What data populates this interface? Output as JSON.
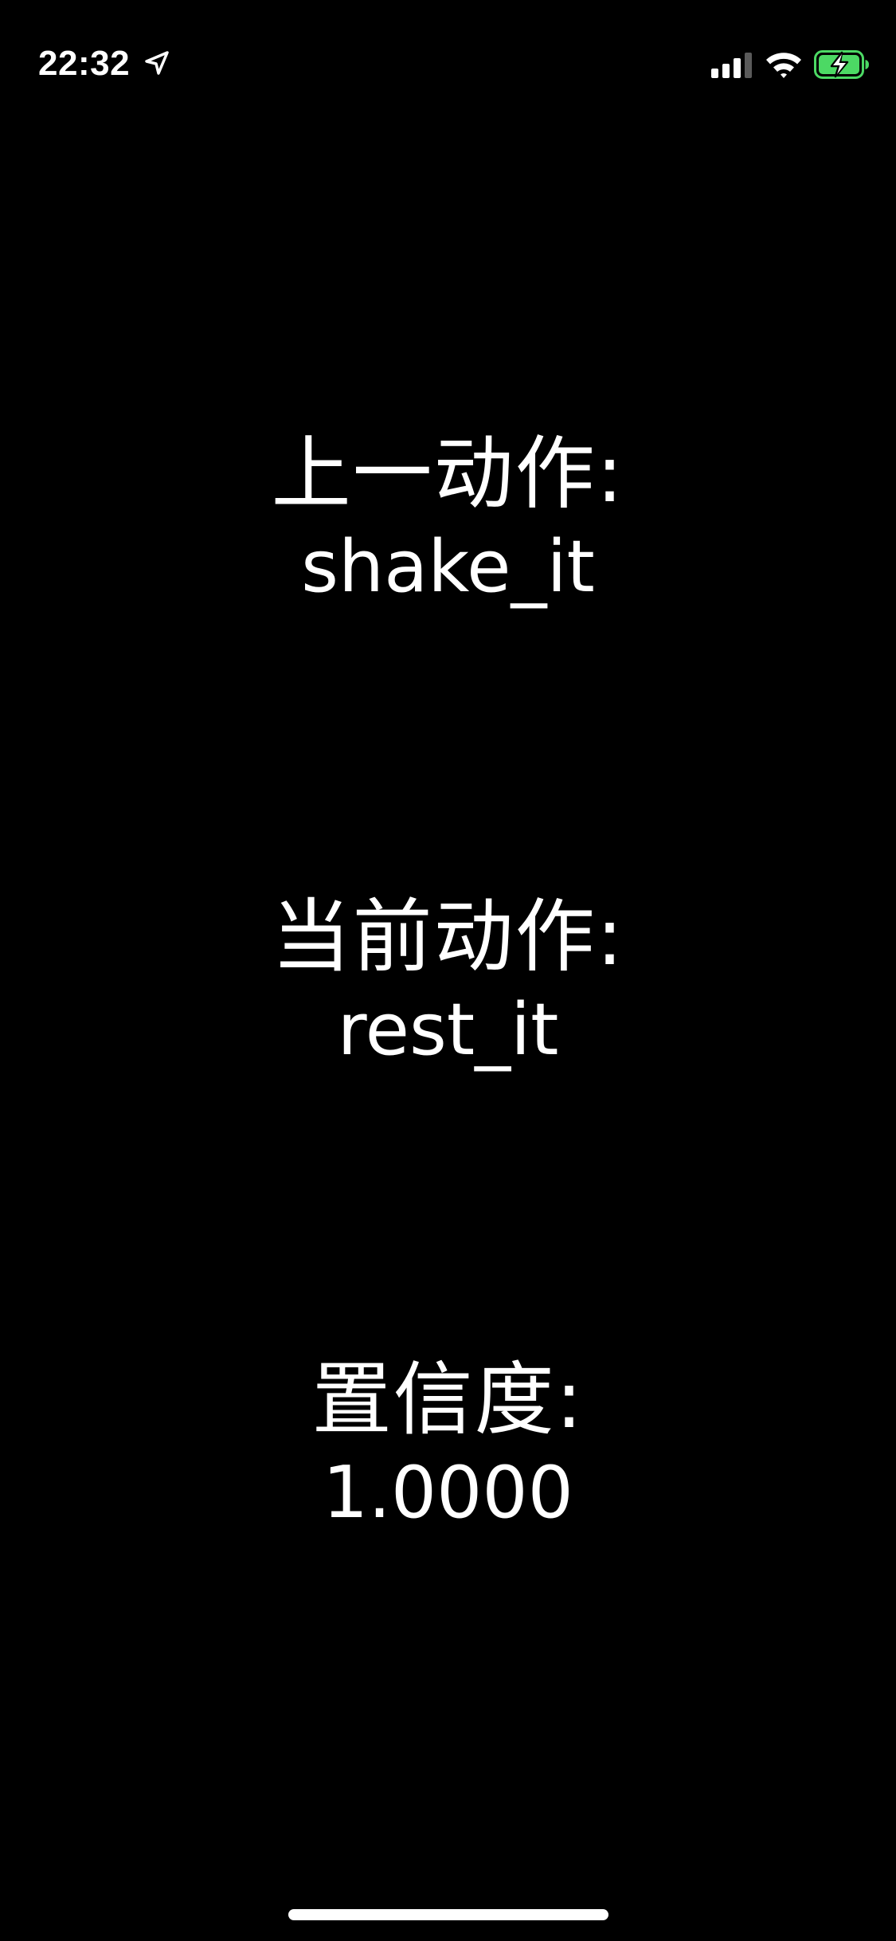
{
  "status_bar": {
    "time": "22:32",
    "icons": {
      "location": "location-arrow-icon",
      "signal": "cellular-signal-icon",
      "wifi": "wifi-icon",
      "battery": "battery-charging-icon"
    },
    "battery_color": "#4cd964"
  },
  "previous_action": {
    "label": "上一动作:",
    "value": "shake_it"
  },
  "current_action": {
    "label": "当前动作:",
    "value": "rest_it"
  },
  "confidence": {
    "label": "置信度:",
    "value": "1.0000"
  },
  "colors": {
    "background": "#000000",
    "text": "#ffffff"
  }
}
